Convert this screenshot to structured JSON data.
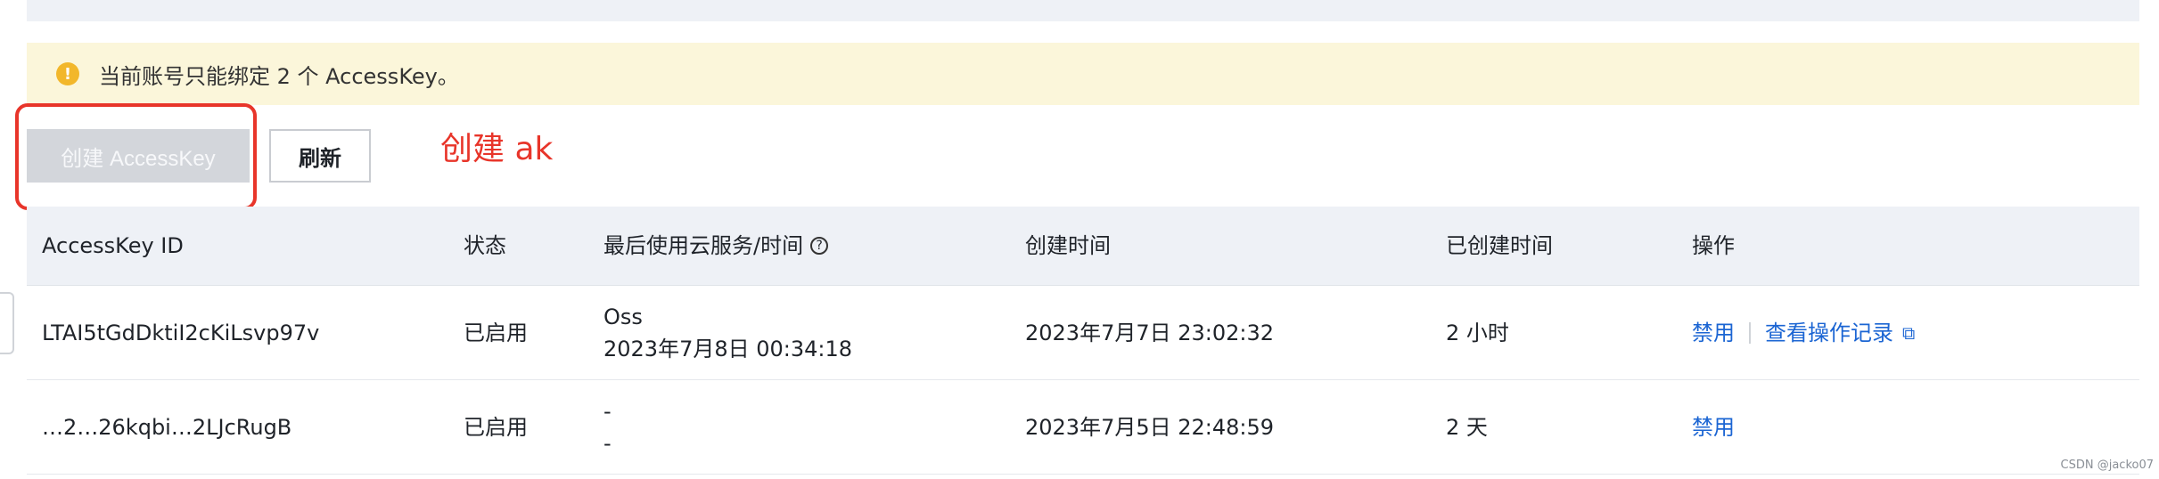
{
  "alert": {
    "text": "当前账号只能绑定 2 个 AccessKey。",
    "icon": "warning-icon"
  },
  "toolbar": {
    "create_label": "创建 AccessKey",
    "refresh_label": "刷新"
  },
  "annotation": {
    "text": "创建 ak",
    "color": "#e8352a"
  },
  "table": {
    "headers": {
      "id": "AccessKey ID",
      "status": "状态",
      "last_used": "最后使用云服务/时间",
      "created_at": "创建时间",
      "age": "已创建时间",
      "ops": "操作"
    },
    "rows": [
      {
        "id": "LTAI5tGdDktiI2cKiLsvp97v",
        "status": "已启用",
        "last_service": "Oss",
        "last_time": "2023年7月8日 00:34:18",
        "created_at": "2023年7月7日 23:02:32",
        "age": "2 小时",
        "op_disable": "禁用",
        "op_logs": "查看操作记录"
      },
      {
        "id": "…2…26kqbi…2LJcRugB",
        "status": "已启用",
        "last_service": "-",
        "last_time": "-",
        "created_at": "2023年7月5日 22:48:59",
        "age": "2 天",
        "op_disable": "禁用",
        "op_logs": ""
      }
    ]
  },
  "colors": {
    "link": "#1b65d3",
    "alert_bg": "#fbf6da",
    "header_bg": "#eef1f6"
  },
  "watermark": "CSDN @jacko07"
}
